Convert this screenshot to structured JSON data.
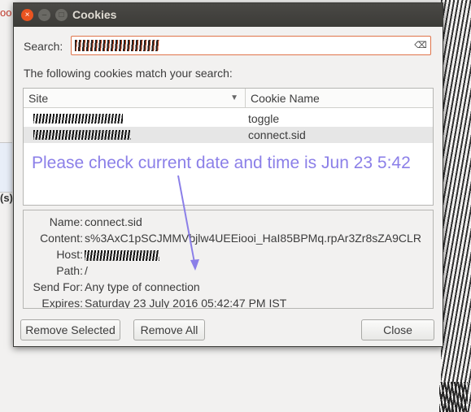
{
  "background": {
    "left_tab_glyph": "oo",
    "left_label": "(s)"
  },
  "dialog": {
    "title": "Cookies",
    "window_controls": {
      "close": "×",
      "minimize": "–",
      "maximize": "□"
    },
    "search": {
      "label": "Search:",
      "value_redacted": true,
      "clear_icon": "clear-icon"
    },
    "match_label": "The following cookies match your search:",
    "columns": {
      "site": "Site",
      "cookie_name": "Cookie Name"
    },
    "rows": [
      {
        "site_redacted": true,
        "name": "toggle",
        "selected": false
      },
      {
        "site_redacted": true,
        "name": "connect.sid",
        "selected": true
      }
    ],
    "annotation": "Please check current date and time is Jun 23 5:42",
    "details": {
      "name_label": "Name:",
      "name_value": "connect.sid",
      "content_label": "Content:",
      "content_value": "s%3AxC1pSCJMMVbjlw4UEEiooi_HaI85BPMq.rpAr3Zr8sZA9CLR",
      "host_label": "Host:",
      "path_label": "Path:",
      "path_value": "/",
      "sendfor_label": "Send For:",
      "sendfor_value": "Any type of connection",
      "expires_label": "Expires:",
      "expires_value": "Saturday 23 July 2016 05:42:47 PM IST"
    },
    "buttons": {
      "remove_selected": "Remove Selected",
      "remove_all": "Remove All",
      "close": "Close"
    },
    "accent_color": "#8b7fe8"
  }
}
